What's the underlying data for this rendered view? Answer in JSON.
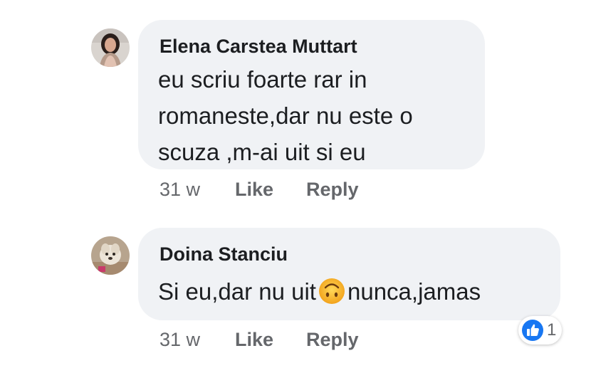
{
  "comments": [
    {
      "author": "Elena Carstea Muttart",
      "text_lines": [
        "eu scriu foarte rar in",
        "romaneste,dar nu este o",
        "scuza ,m-ai uit si eu"
      ],
      "time": "31 w",
      "like_label": "Like",
      "reply_label": "Reply"
    },
    {
      "author": "Doina Stanciu",
      "text_before_emoji": "Si eu,dar nu uit",
      "emoji": "upside-down-face-icon",
      "text_after_emoji": "nunca,jamas",
      "time": "31 w",
      "like_label": "Like",
      "reply_label": "Reply",
      "reaction_count": "1"
    }
  ],
  "colors": {
    "bubble": "#f0f2f5",
    "text": "#1c1e21",
    "meta": "#65676b",
    "like_blue": "#1877f2"
  }
}
